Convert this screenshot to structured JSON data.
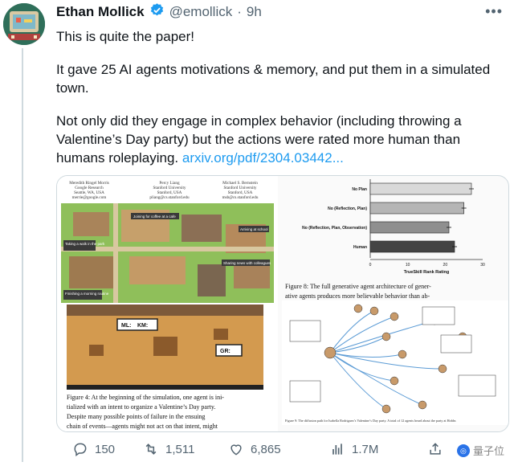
{
  "tweet": {
    "author_name": "Ethan Mollick",
    "handle": "@emollick",
    "separator": "·",
    "time": "9h",
    "paragraphs": [
      "This is quite the paper!",
      "It gave 25 AI agents motivations & memory, and put them in a simulated town.",
      "Not only did they engage in complex behavior (including throwing a Valentine’s Day party) but the actions were rated more human than humans roleplaying."
    ],
    "link_text": "arxiv.org/pdf/2304.03442..."
  },
  "paper": {
    "authors": [
      {
        "name": "Meredith Ringel Morris",
        "affil": "Google Research",
        "loc": "Seattle, WA, USA",
        "email": "merrie@google.com"
      },
      {
        "name": "Percy Liang",
        "affil": "Stanford University",
        "loc": "Stanford, USA",
        "email": "pliang@cs.stanford.edu"
      },
      {
        "name": "Michael S. Bernstein",
        "affil": "Stanford University",
        "loc": "Stanford, USA",
        "email": "msb@cs.stanford.edu"
      }
    ],
    "fig4_caption_1": "Figure 4: At the beginning of the simulation, one agent is ini-",
    "fig4_caption_2": "tialized with an intent to organize a Valentine’s Day party.",
    "fig4_caption_3": "Despite many possible points of failure in the ensuing",
    "fig4_caption_4": "chain of events—agents might not act on that intent, might",
    "fig8_caption_1": "Figure 8: The full generative agent architecture of gener-",
    "fig8_caption_2": "ative agents produces more believable behavior than ab-",
    "fig9_caption": "Figure 9: The diffusion path for Isabella Rodriguez’s Valentine’s Day party. A total of 12 agents heard about the party at Hobbs",
    "bubbles": {
      "ml": "ML:",
      "km": "KM:",
      "gr": "GR:"
    },
    "map_labels": [
      "Joining for coffee at a cafe",
      "Taking a walk in the park",
      "Arriving at school",
      "Finishing a morning routine",
      "Sharing news with colleagues"
    ]
  },
  "chart_data": {
    "type": "bar",
    "categories": [
      "No Plan",
      "No (Reflection, Plan)",
      "No (Reflection, Plan, Observation)",
      "Human"
    ],
    "values": [
      27,
      25,
      21,
      22.5
    ],
    "xlabel": "TrueSkill Rank Rating",
    "ylabel": "",
    "xlim": [
      0,
      30
    ],
    "xticks": [
      "0",
      "10",
      "20",
      "30"
    ]
  },
  "actions": {
    "replies": "150",
    "retweets": "1,511",
    "likes": "6,865",
    "views": "1.7M"
  },
  "watermark": "量子位",
  "colors": {
    "link": "#1d9bf0",
    "verified": "#1d9bf0",
    "muted": "#536471"
  }
}
